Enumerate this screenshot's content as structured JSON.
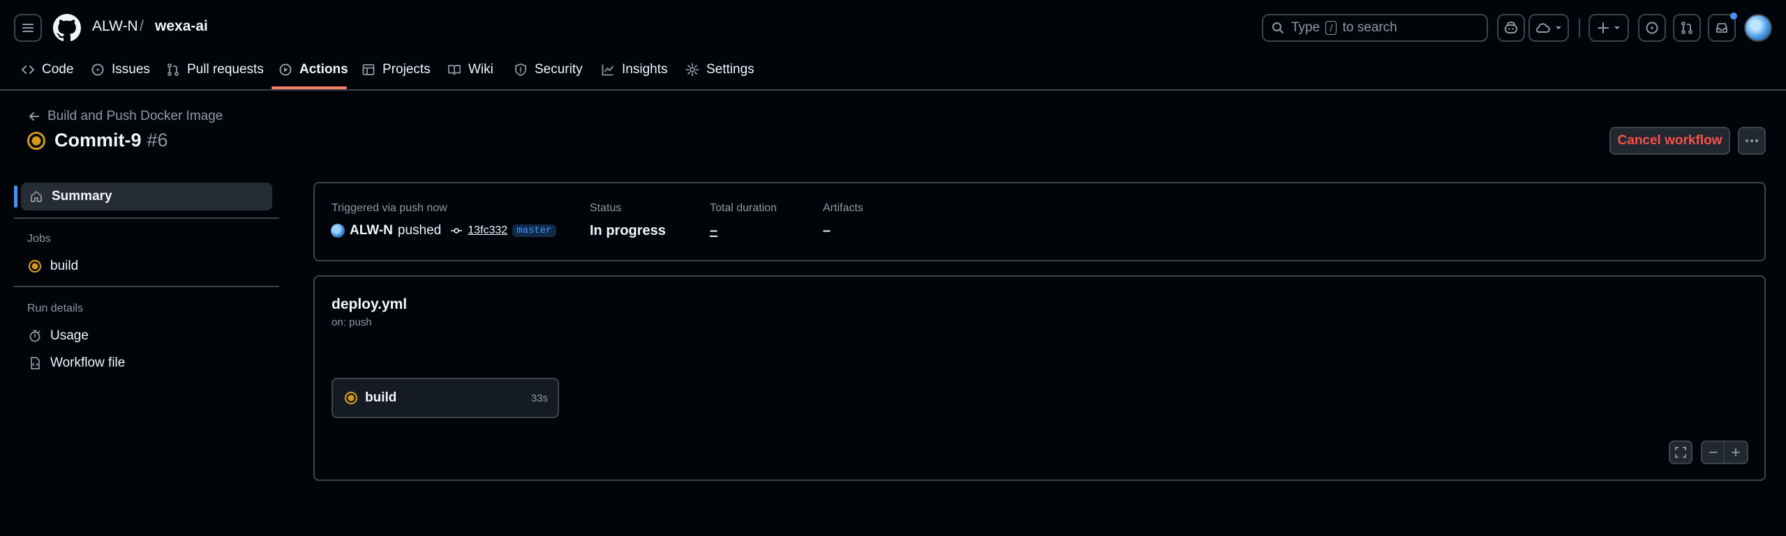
{
  "header": {
    "owner": "ALW-N",
    "separator": "/",
    "repo": "wexa-ai",
    "search": {
      "prefix": "Type",
      "key": "/",
      "suffix": "to search"
    }
  },
  "nav": {
    "tabs": [
      {
        "label": "Code",
        "icon": "code-icon"
      },
      {
        "label": "Issues",
        "icon": "issue-icon"
      },
      {
        "label": "Pull requests",
        "icon": "pull-request-icon"
      },
      {
        "label": "Actions",
        "icon": "play-icon",
        "active": true
      },
      {
        "label": "Projects",
        "icon": "table-icon"
      },
      {
        "label": "Wiki",
        "icon": "book-icon"
      },
      {
        "label": "Security",
        "icon": "shield-icon"
      },
      {
        "label": "Insights",
        "icon": "graph-icon"
      },
      {
        "label": "Settings",
        "icon": "gear-icon"
      }
    ]
  },
  "run": {
    "workflow_name": "Build and Push Docker Image",
    "title": "Commit-9",
    "number": "#6",
    "cancel_label": "Cancel workflow"
  },
  "sidebar": {
    "summary_label": "Summary",
    "jobs_heading": "Jobs",
    "jobs": [
      {
        "label": "build"
      }
    ],
    "run_details_heading": "Run details",
    "details": [
      {
        "label": "Usage",
        "icon": "stopwatch-icon"
      },
      {
        "label": "Workflow file",
        "icon": "file-code-icon"
      }
    ]
  },
  "summary": {
    "triggered_label": "Triggered via push now",
    "actor": "ALW-N",
    "action": "pushed",
    "commit_sha": "13fc332",
    "branch": "master",
    "status_label": "Status",
    "status_value": "In progress",
    "duration_label": "Total duration",
    "duration_value": "–",
    "artifacts_label": "Artifacts",
    "artifacts_value": "–"
  },
  "graph": {
    "workflow_file": "deploy.yml",
    "trigger": "on: push",
    "jobs": [
      {
        "name": "build",
        "duration": "33s",
        "status": "in-progress"
      }
    ]
  },
  "colors": {
    "background": "#010409",
    "border": "#3d444d",
    "accent_blue": "#4493f8",
    "tab_underline": "#f78166",
    "danger": "#f85149",
    "in_progress": "#d29922"
  }
}
